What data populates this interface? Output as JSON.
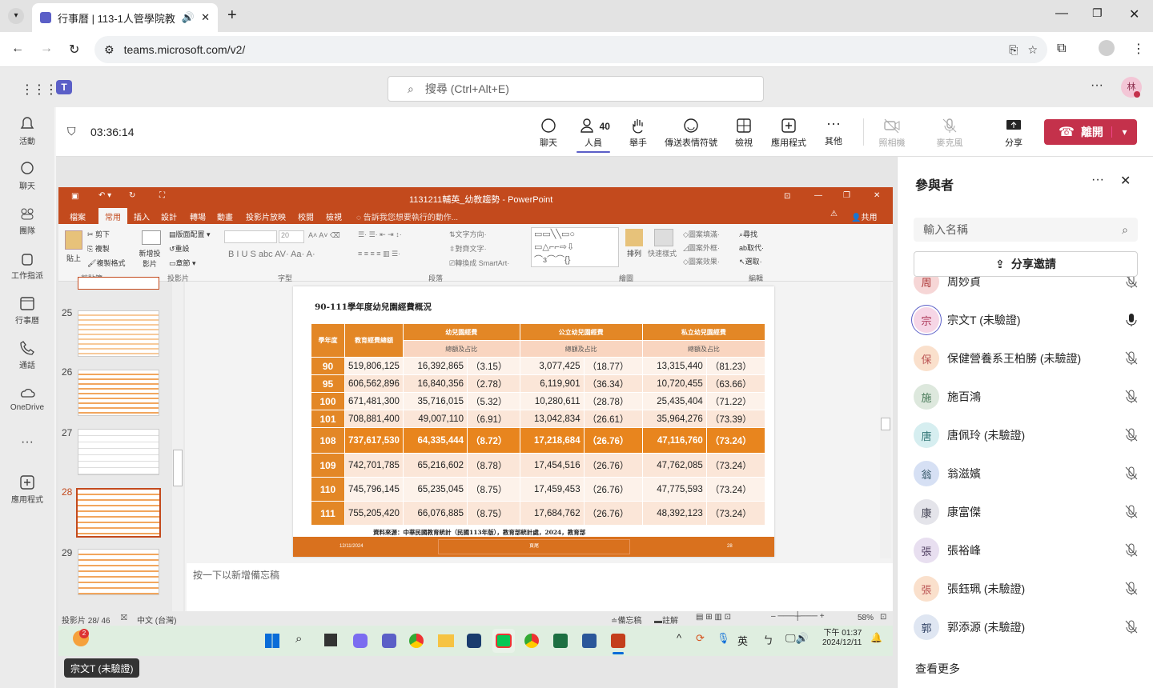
{
  "browser": {
    "tab_title": "行事曆 | 113-1人管學院教師",
    "url": "teams.microsoft.com/v2/"
  },
  "teams": {
    "search_placeholder": "搜尋 (Ctrl+Alt+E)",
    "user_initial": "林"
  },
  "rail": [
    {
      "label": "活動"
    },
    {
      "label": "聊天"
    },
    {
      "label": "團隊"
    },
    {
      "label": "工作指派"
    },
    {
      "label": "行事曆"
    },
    {
      "label": "通話"
    },
    {
      "label": "OneDrive"
    },
    {
      "label": "應用程式"
    }
  ],
  "meeting": {
    "timer": "03:36:14",
    "people_count": "40",
    "buttons": {
      "chat": "聊天",
      "people": "人員",
      "raise": "舉手",
      "react": "傳送表情符號",
      "view": "檢視",
      "apps": "應用程式",
      "more": "其他",
      "camera": "照相機",
      "mic": "麥克風",
      "share": "分享"
    },
    "leave": "離開"
  },
  "ppt": {
    "title": "1131211輔英_幼教趨勢 - PowerPoint",
    "menu": [
      "檔案",
      "常用",
      "插入",
      "設計",
      "轉場",
      "動畫",
      "投影片放映",
      "校閱",
      "檢視"
    ],
    "tell": "告訴我您想要執行的動作...",
    "share": "共用",
    "ribbon": {
      "paste": "貼上",
      "cut": "剪下",
      "copy": "複製",
      "format": "複製格式",
      "clipboard": "剪貼簿",
      "new_slide": "新增投影片",
      "layout": "版面配置",
      "reset": "重設",
      "section": "章節",
      "slides": "投影片",
      "font": "字型",
      "font_size": "20",
      "paragraph": "段落",
      "text_dir": "文字方向",
      "align_text": "對齊文字",
      "smartart": "轉換成 SmartArt",
      "drawing": "繪圖",
      "arrange": "排列",
      "quick_styles": "快速樣式",
      "fill": "圖案填滿",
      "outline": "圖案外框",
      "effects": "圖案效果",
      "find": "尋找",
      "replace": "取代",
      "select": "選取",
      "editing": "編輯"
    },
    "thumb_numbers": [
      "25",
      "26",
      "27",
      "28",
      "29"
    ],
    "notes": "按一下以新增備忘稿",
    "status": {
      "slide": "投影片 28/ 46",
      "lang": "中文 (台灣)",
      "notes": "備忘稿",
      "comments": "註解",
      "zoom": "58%"
    }
  },
  "slide": {
    "title": "90-111學年度幼兒園經費概況",
    "headers": {
      "year": "學年度",
      "total": "教育經費總額",
      "preschool": "幼兒園經費",
      "public": "公立幼兒園經費",
      "private": "私立幼兒園經費",
      "sub": "總額及占比"
    },
    "rows": [
      {
        "year": "90",
        "total": "519,806,125",
        "k": "16,392,865（3.15）",
        "pub": "3,077,425（18.77）",
        "pri": "13,315,440（81.23）"
      },
      {
        "year": "95",
        "total": "606,562,896",
        "k": "16,840,356（2.78）",
        "pub": "6,119,901（36.34）",
        "pri": "10,720,455（63.66）"
      },
      {
        "year": "100",
        "total": "671,481,300",
        "k": "35,716,015（5.32）",
        "pub": "10,280,611（28.78）",
        "pri": "25,435,404（71.22）"
      },
      {
        "year": "101",
        "total": "708,881,400",
        "k": "49,007,110（6.91）",
        "pub": "13,042,834（26.61）",
        "pri": "35,964,276（73.39）"
      },
      {
        "year": "108",
        "total": "737,617,530",
        "k": "64,335,444（8.72）",
        "pub": "17,218,684（26.76）",
        "pri": "47,116,760（73.24）"
      },
      {
        "year": "109",
        "total": "742,701,785",
        "k": "65,216,602（8.78）",
        "pub": "17,454,516（26.76）",
        "pri": "47,762,085（73.24）"
      },
      {
        "year": "110",
        "total": "745,796,145",
        "k": "65,235,045（8.75）",
        "pub": "17,459,453（26.76）",
        "pri": "47,775,593（73.24）"
      },
      {
        "year": "111",
        "total": "755,205,420",
        "k": "66,076,885（8.75）",
        "pub": "17,684,762（26.76）",
        "pri": "48,392,123（73.24）"
      }
    ],
    "source": "資料來源：中華民國教育統計（民國113年版），教育部統計處，2024，教育部",
    "footer_date": "12/11/2024",
    "footer_mid": "頁尾",
    "footer_num": "28"
  },
  "taskbar": {
    "time": "下午 01:37",
    "date": "2024/12/11",
    "ime": "英",
    "badge": "2"
  },
  "speaker_tag": "宗文T (未驗證)",
  "panel": {
    "title": "參與者",
    "search_placeholder": "輸入名稱",
    "invite": "分享邀請",
    "more": "查看更多",
    "people": [
      {
        "initial": "周",
        "name": "周妙貞",
        "color": "#f6d6d6",
        "fg": "#a33"
      },
      {
        "initial": "宗",
        "name": "宗文T (未驗證)",
        "color": "#f6d6e6",
        "fg": "#a35"
      },
      {
        "initial": "保",
        "name": "保健營養系王柏勝 (未驗證)",
        "color": "#fae0cc",
        "fg": "#b55"
      },
      {
        "initial": "施",
        "name": "施百鴻",
        "color": "#dde8dd",
        "fg": "#475"
      },
      {
        "initial": "唐",
        "name": "唐佩玲 (未驗證)",
        "color": "#d6eef0",
        "fg": "#377"
      },
      {
        "initial": "翁",
        "name": "翁滋嬪",
        "color": "#d6e0f4",
        "fg": "#356"
      },
      {
        "initial": "康",
        "name": "康富傑",
        "color": "#e4e4ea",
        "fg": "#445"
      },
      {
        "initial": "張",
        "name": "張裕峰",
        "color": "#e8dff0",
        "fg": "#546"
      },
      {
        "initial": "張",
        "name": "張鈺珮 (未驗證)",
        "color": "#fae0cc",
        "fg": "#b55"
      },
      {
        "initial": "郭",
        "name": "郭添源 (未驗證)",
        "color": "#dfe6f2",
        "fg": "#346"
      }
    ]
  }
}
